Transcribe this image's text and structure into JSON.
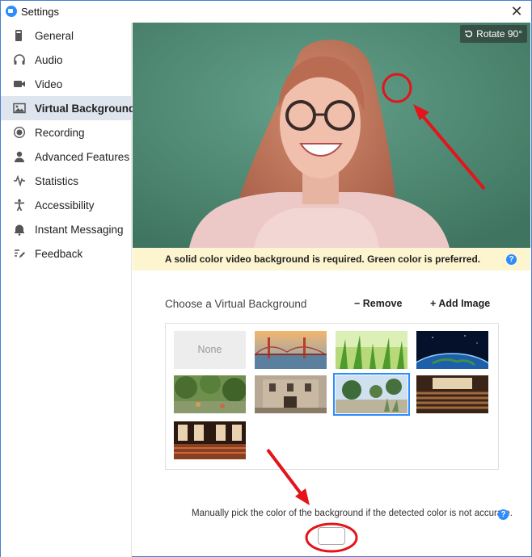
{
  "window": {
    "title": "Settings"
  },
  "sidebar": {
    "items": [
      {
        "label": "General",
        "icon": "general-icon"
      },
      {
        "label": "Audio",
        "icon": "headphones-icon"
      },
      {
        "label": "Video",
        "icon": "camera-icon"
      },
      {
        "label": "Virtual Background",
        "icon": "image-icon",
        "active": true
      },
      {
        "label": "Recording",
        "icon": "record-icon"
      },
      {
        "label": "Advanced Features",
        "icon": "user-icon"
      },
      {
        "label": "Statistics",
        "icon": "pulse-icon"
      },
      {
        "label": "Accessibility",
        "icon": "accessibility-icon"
      },
      {
        "label": "Instant Messaging",
        "icon": "bell-icon"
      },
      {
        "label": "Feedback",
        "icon": "pencil-icon"
      }
    ]
  },
  "preview": {
    "rotate_label": "Rotate 90°"
  },
  "notice": {
    "text": "A solid color video background is required. Green color is preferred."
  },
  "backgrounds": {
    "title": "Choose a Virtual Background",
    "remove_label": "Remove",
    "add_label": "Add Image",
    "none_label": "None"
  },
  "manual": {
    "text": "Manually pick the color of the background if the detected color is not accurate."
  },
  "colors": {
    "accent": "#2d8cff",
    "notice_bg": "#fdf5cf",
    "active_nav": "#dfe5ee",
    "annotation": "#e3141a"
  }
}
